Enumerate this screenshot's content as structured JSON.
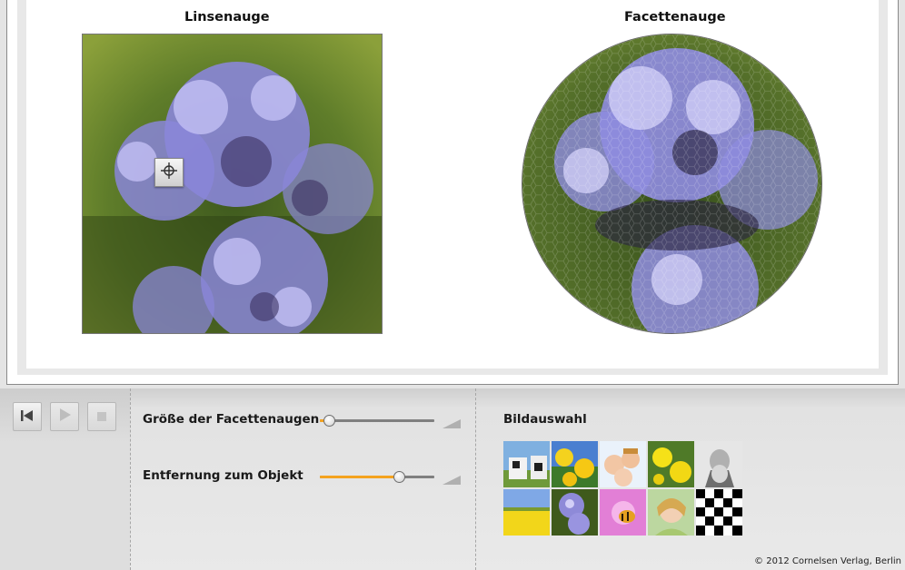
{
  "display": {
    "lens_title": "Linsenauge",
    "facet_title": "Facettenauge"
  },
  "controls": {
    "facet_size": {
      "label": "Größe der Facettenaugen",
      "value_fraction": 0.08
    },
    "distance": {
      "label": "Entfernung zum Objekt",
      "value_fraction": 0.69
    },
    "media_buttons": [
      {
        "name": "rewind",
        "icon": "skip-to-start-icon",
        "enabled": true
      },
      {
        "name": "play",
        "icon": "play-icon",
        "enabled": false
      },
      {
        "name": "stop",
        "icon": "stop-icon",
        "enabled": false
      }
    ]
  },
  "image_selection": {
    "title": "Bildauswahl",
    "images": [
      {
        "subject": "cows"
      },
      {
        "subject": "dandelions"
      },
      {
        "subject": "children"
      },
      {
        "subject": "yellow-flowers"
      },
      {
        "subject": "old-man-portrait"
      },
      {
        "subject": "rapeseed-field"
      },
      {
        "subject": "purple-flower"
      },
      {
        "subject": "bee-on-flower"
      },
      {
        "subject": "smiling-girl"
      },
      {
        "subject": "checkerboard"
      }
    ]
  },
  "footer": {
    "copyright": "© 2012 Cornelsen Verlag, Berlin"
  },
  "colors": {
    "slider_accent": "#f4a21e",
    "flower": "#8a86d8"
  }
}
